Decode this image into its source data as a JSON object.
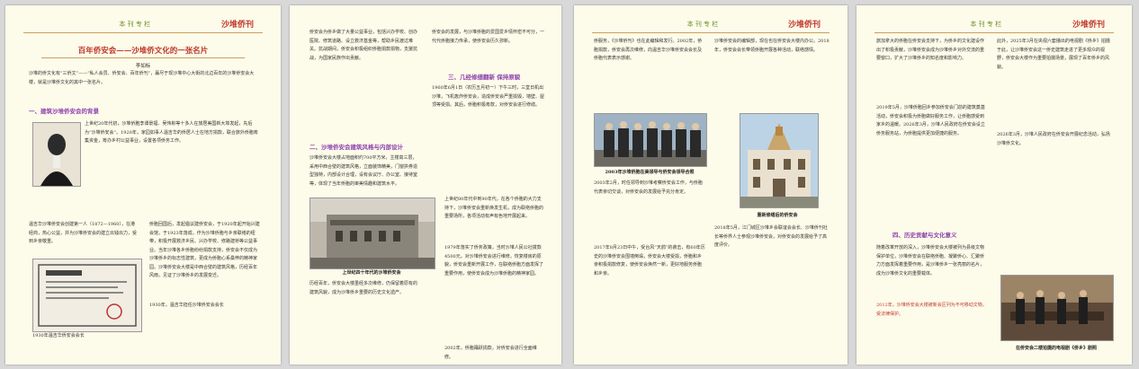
{
  "header": {
    "column": "本 刊 专 栏",
    "journal": "沙堆侨刊"
  },
  "p1": {
    "title": "百年侨安会——沙堆侨文化的一张名片",
    "author": "李如标",
    "intro": "沙堆的侨文化有“三侨文”——“私人会员、侨安会、百年侨刊”，赢尽于现沙堆中心大街的北边百年的沙堆侨安会大楼，就是沙堆侨文化的其中一张名片。",
    "sec1": "一、建筑沙堆侨安会的背景",
    "left_text": "上世纪20年代初，沙堆侨胞李谭景福、吴伟彬等十多人在旅居美国新大埠发起，先后为“沙堆侨安会”。1920年，家园如事人温吉华的侨居人士在地方捐款，联合旅外侨胞筹集资金，筹办乡村公益事业，设置各项侨务工作。",
    "left_text2": "温吉华沙堆侨安会创建第一人（1872—1960），在港经商，热心公益，并为沙堆侨安会的建立出钱出力，受到乡亲敬重。",
    "right_text": "侨胞回国后，发起倡议建侨安会，于1920年起开始兴建会馆，于1923年落成，作为沙堆侨胞与乡亲联络的纽带，积极开展救济乡民、兴办学校、修路建桥等公益事业。当年沙堆各乡侨胞纷纷捐款支持，侨安会不仅成为沙堆侨乡的标志性建筑，更成为侨胞心系桑梓的精神家园。沙堆侨安会大楼是中西合璧的建筑风格，历经百年风雨，见证了沙堆侨乡的发展变迁。",
    "caption1": "1930年温吉华侨安会会长",
    "caption2": "1930年，温吉华担任沙堆侨安会会长"
  },
  "p2": {
    "text1": "侨安会为侨乡做了大量公益事业，包括兴办学校、创办医院、修筑道路、设立救济基金等，帮助乡民渡过难关。抗战期间，侨安会积极组织侨胞捐款捐物，支援抗战，为国家民族作出贡献。",
    "sec2": "二、沙堆侨安会建筑风格与内部设计",
    "text2": "沙堆侨安会大楼占地面积约700平方米，主楼高三层，采用中西合璧的建筑风格，立面装饰精美，门窗拱券造型独特，内部设计合理，设有会议厅、办公室、接待室等，体现了当年侨胞的审美情趣和建筑水平。",
    "caption1": "上世纪四十年代的沙堆侨安会",
    "text3": "历经百年，侨安会大楼虽经多次维修，仍保留着原有的建筑风貌，成为沙堆侨乡重要的历史文化遗产。",
    "text4": "侨安会的发展，与沙堆侨胞的爱国爱乡情怀密不可分，一代代侨胞接力传承，使侨安会历久弥新。",
    "sec3": "三、几经修缮翻新 保持原貌",
    "text5": "1960年6月1日（农历五月初一）下午三时，三堂日机出沙堆，飞机轰炸侨安会，造成侨安会严重损毁，墙壁、屋顶等受损。其后，侨胞积极筹款，对侨安会进行修缮。",
    "text6": "上世纪80年代中到90年代，在各个侨胞的大力支持下，沙堆侨安会重新焕发生机，成为联络侨胞的重要场所，各项活动有声有色地开展起来。",
    "text7": "1979年落实了侨务政策，当时沙堆人民公社拨款4500元，对沙堆侨安会进行维修，恢复楼房的原貌，侨安会重新开展工作，在联络侨胞方面发挥了重要作用，使侨安会成为沙堆侨胞的精神家园。",
    "text8": "2002年，侨胞踊跃捐款，对侨安会进行全面维修。"
  },
  "p3": {
    "text1": "侨服务，《沙堆侨刊》也在此编辑和发行。2002年，侨胞捐款，侨安会再次维修，向温吉华沙堆侨安会会长及侨胞代表表示感谢。",
    "text2": "2003年2月，时任领导到沙堆考察侨安会工作，与侨胞代表亲切交谈，对侨安会的发展给予充分肯定。",
    "caption1": "2003年沙堆侨胞在美领导与侨安会领导合照",
    "text3": "2017年8月23日中午，受台风“天鸽”的袭击，有60年历史的沙堆侨安会围墙倒塌，侨安会大楼受损，侨胞和乡亲积极捐款修复，使侨安会焕然一新，更好地服务侨胞和乡亲。",
    "right1": "沙堆侨安会的编辑部，现在也在侨安会大楼内办公。2018年，侨安会会长带领侨胞开展各种活动，联络感情。",
    "caption2": "重新修缮后的侨安会",
    "right2": "2018年5月，江门城区沙堆乡会联谊会会长、沙堆侨刊社长等侨界人士参观沙堆侨安会，对侨安会的发展给予了高度评价。"
  },
  "p4": {
    "text1": "旅加拿大的侨胞在侨安会支持下，为侨乡的文化建设作出了积极贡献，沙堆侨安会成为沙堆侨乡对外交流的重要窗口，扩大了沙堆侨乡的知名度和影响力。",
    "text2": "2019年5月，沙堆侨胞回乡参加侨安会门前的建筑奠基活动，侨安会积极为侨胞做好服务工作，让侨胞感受到家乡的温暖。2026年3月，沙堆人民政府在侨安会设立侨务服务站，为侨胞提供更加便捷的服务。",
    "sec4": "四、历史贡献与文化意义",
    "text3": "随着改革开放的深入，沙堆侨安会大楼被列为县级文物保护单位，沙堆侨安会在联络侨胞、凝聚侨心、汇聚侨力方面发挥着重要作用，是沙堆侨乡一张亮丽的名片，成为沙堆侨文化的重要载体。",
    "highlight": "2012年，沙堆侨安会大楼被新会区列为不可移动文物，受法律保护。",
    "right1": "此外，2025年3月在央视六套播出的电视剧《侨乡》拍摄于此，让沙堆侨安会这一侨史建筑走进了更多观众的视野，侨安会大楼作为重要拍摄场景，展现了百年侨乡的风貌。",
    "right2": "2026年3月，沙堆人民政府在侨安会开展纪念活动，弘扬沙堆侨文化。",
    "caption1": "在侨安会二楼拍摄的电视剧《侨乡》剧照"
  }
}
